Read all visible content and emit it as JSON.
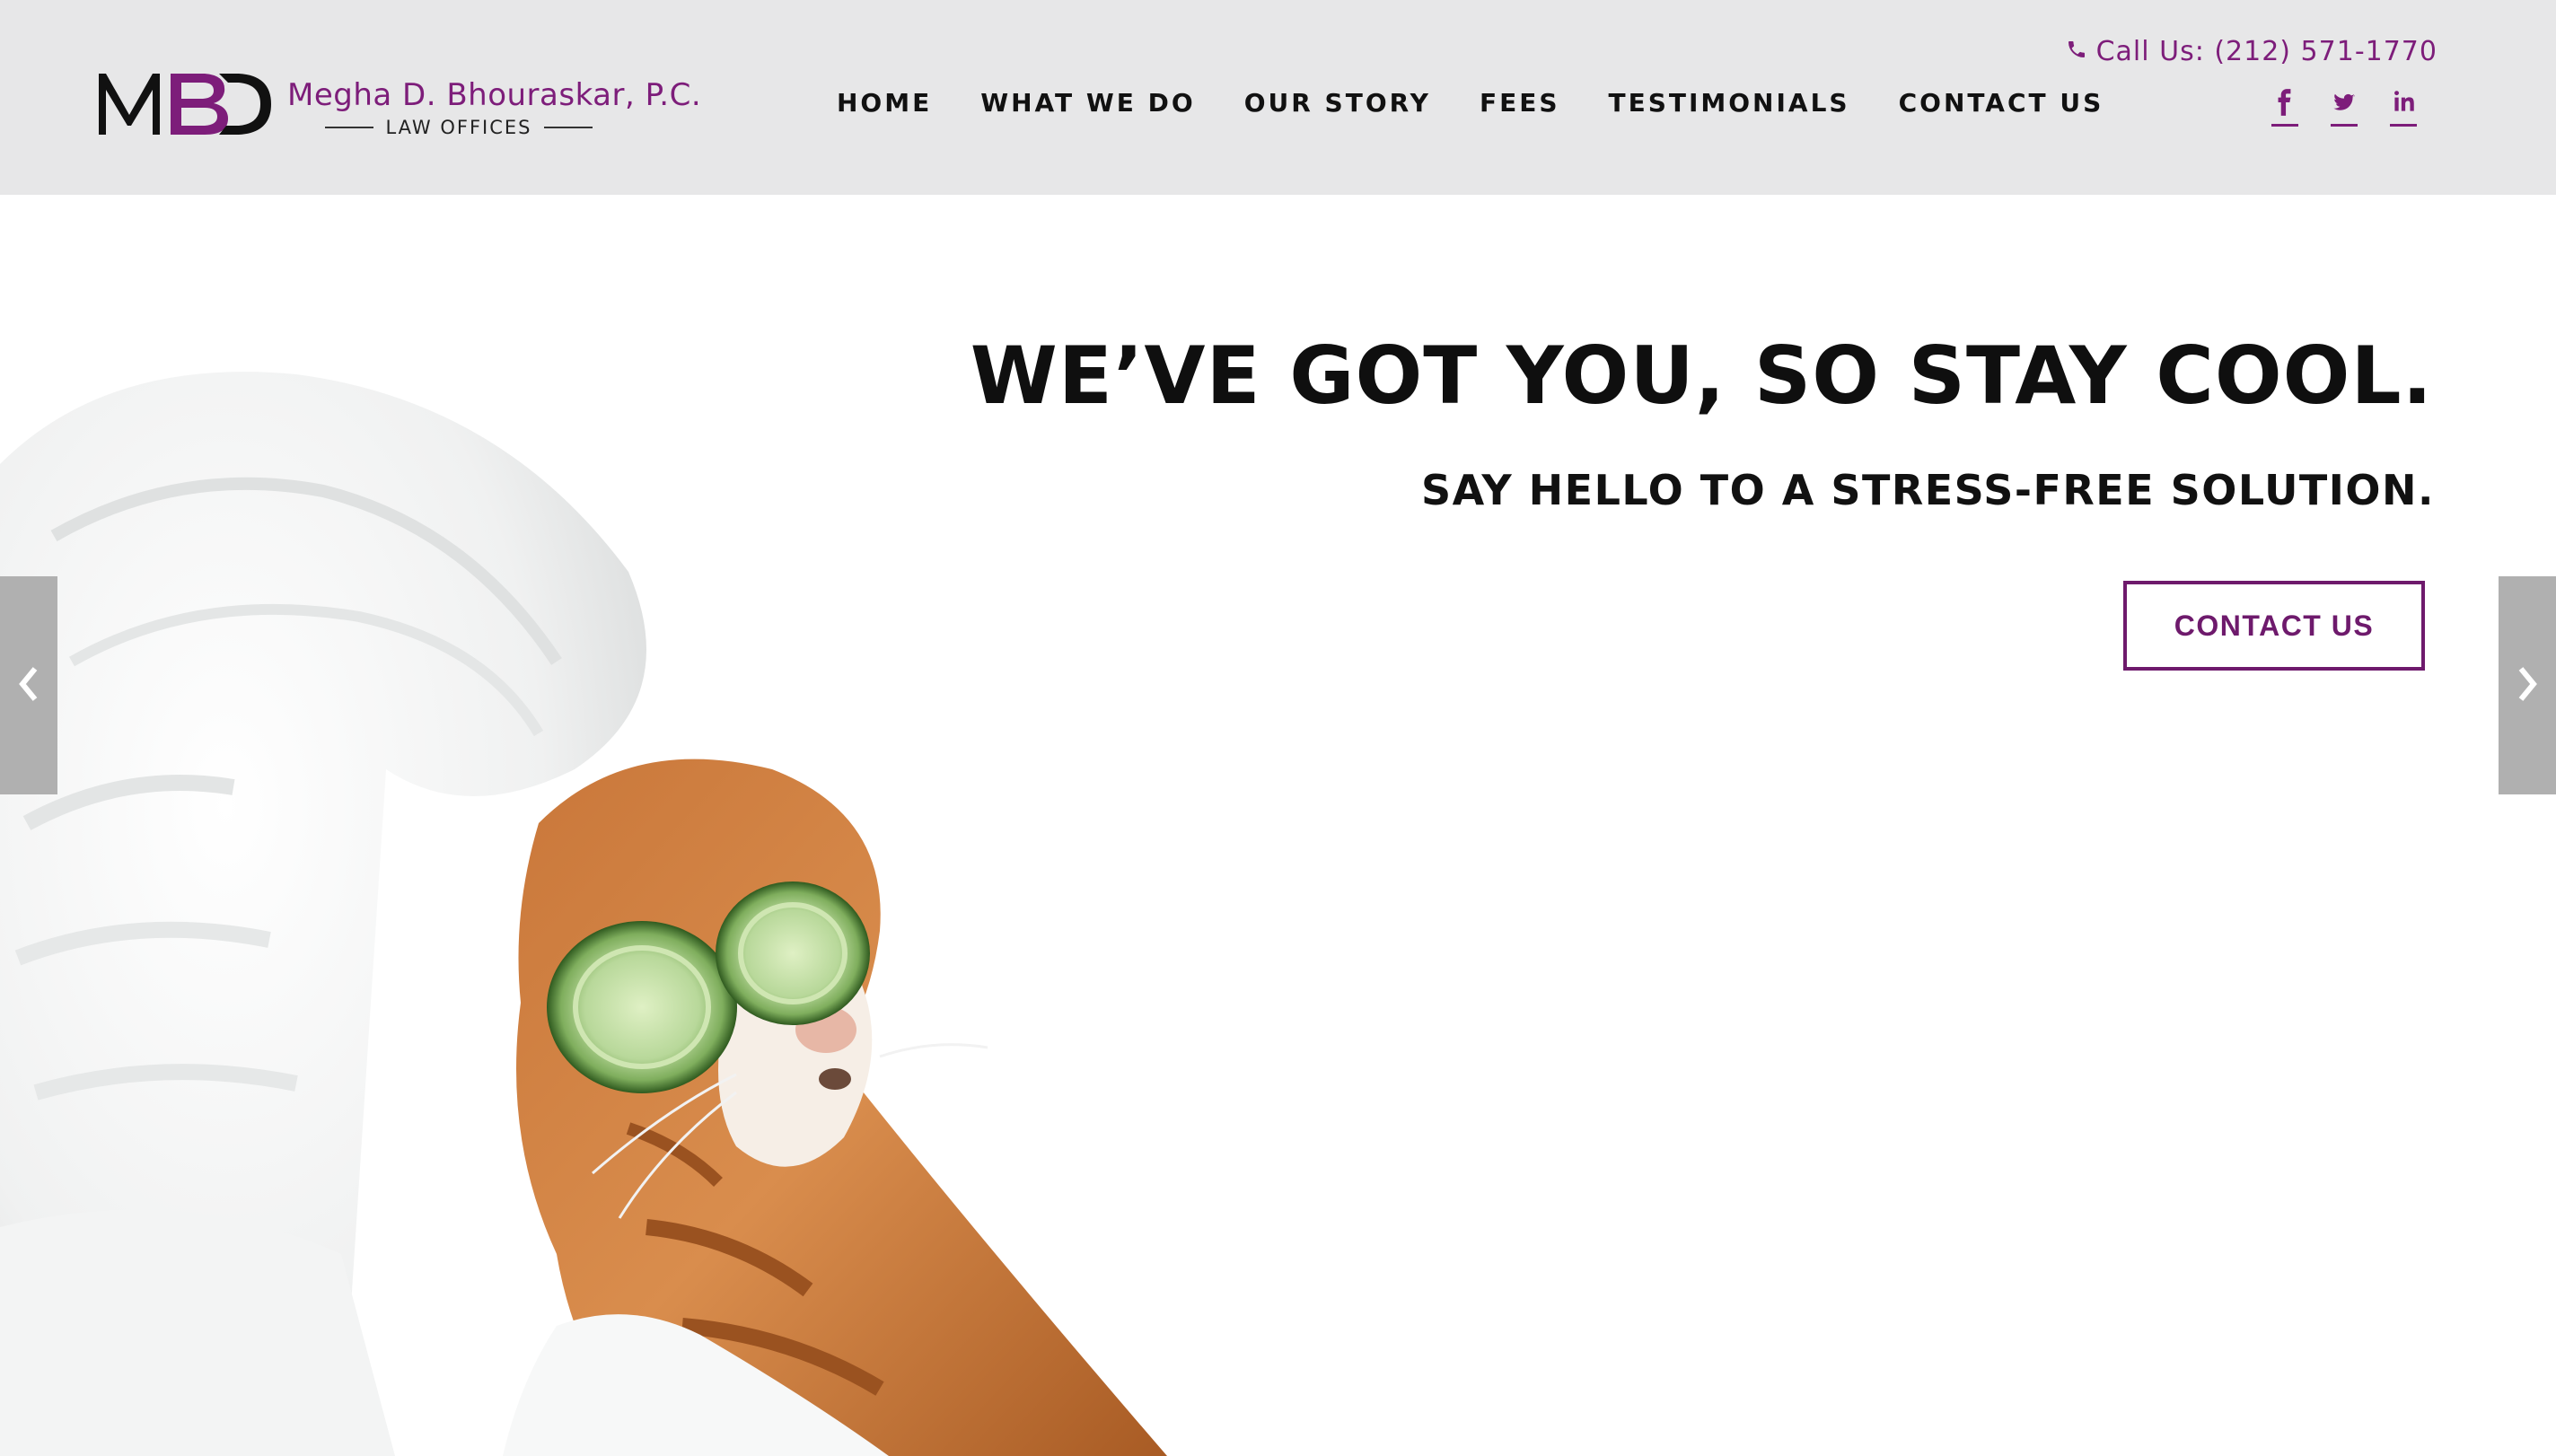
{
  "brand": {
    "logo_text": "MBD",
    "name": "Megha D. Bhouraskar, P.C.",
    "tagline": "LAW OFFICES"
  },
  "nav": {
    "items": [
      {
        "label": "HOME"
      },
      {
        "label": "WHAT WE DO"
      },
      {
        "label": "OUR STORY"
      },
      {
        "label": "FEES"
      },
      {
        "label": "TESTIMONIALS"
      },
      {
        "label": "CONTACT US"
      }
    ]
  },
  "contact": {
    "phone_label": "Call Us: (212) 571-1770",
    "phone_icon": "phone-icon"
  },
  "social": {
    "icons": [
      "facebook-icon",
      "twitter-icon",
      "linkedin-icon"
    ]
  },
  "hero": {
    "headline": "WE’VE GOT YOU, SO STAY COOL.",
    "subhead": "SAY HELLO TO A STRESS-FREE SOLUTION.",
    "cta_label": "CONTACT US",
    "image": "cat-spa-towel-cucumber-image",
    "prev_icon": "chevron-left-icon",
    "next_icon": "chevron-right-icon"
  },
  "colors": {
    "accent": "#7d1d7a",
    "header_bg": "#e7e7e8",
    "text": "#111111",
    "arrow_bg": "#b0b0b0"
  }
}
